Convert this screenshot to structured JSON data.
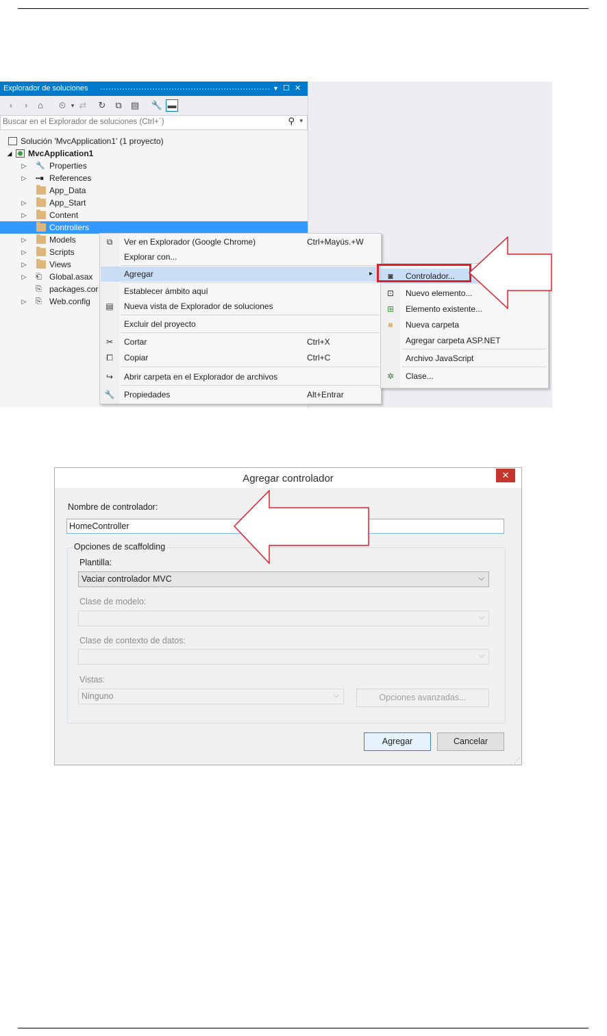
{
  "solution_explorer": {
    "title": "Explorador de soluciones",
    "search_placeholder": "Buscar en el Explorador de soluciones (Ctrl+´)",
    "tree": [
      {
        "label": "Solución 'MvcApplication1'  (1 proyecto)",
        "icon": "solution-icon"
      },
      {
        "label": "MvcApplication1",
        "icon": "web-project-icon"
      },
      {
        "label": "Properties",
        "icon": "wrench-icon"
      },
      {
        "label": "References",
        "icon": "references-icon"
      },
      {
        "label": "App_Data",
        "icon": "folder-icon"
      },
      {
        "label": "App_Start",
        "icon": "folder-icon"
      },
      {
        "label": "Content",
        "icon": "folder-icon"
      },
      {
        "label": "Controllers",
        "icon": "folder-icon",
        "selected": true
      },
      {
        "label": "Models",
        "icon": "folder-icon"
      },
      {
        "label": "Scripts",
        "icon": "folder-icon"
      },
      {
        "label": "Views",
        "icon": "folder-icon"
      },
      {
        "label": "Global.asax",
        "icon": "asax-file-icon"
      },
      {
        "label": "packages.cor",
        "icon": "config-file-icon"
      },
      {
        "label": "Web.config",
        "icon": "config-file-icon"
      }
    ]
  },
  "context_menu": {
    "items": [
      {
        "label": "Ver en Explorador (Google Chrome)",
        "shortcut": "Ctrl+Mayús.+W"
      },
      {
        "label": "Explorar con..."
      },
      {
        "label": "Agregar",
        "submenu_arrow": "▸"
      },
      {
        "label": "Establecer ámbito aquí"
      },
      {
        "label": "Nueva vista de Explorador de soluciones"
      },
      {
        "label": "Excluir del proyecto"
      },
      {
        "label": "Cortar",
        "shortcut": "Ctrl+X"
      },
      {
        "label": "Copiar",
        "shortcut": "Ctrl+C"
      },
      {
        "label": "Abrir carpeta en el Explorador de archivos"
      },
      {
        "label": "Propiedades",
        "shortcut": "Alt+Entrar"
      }
    ]
  },
  "add_submenu": {
    "items": [
      {
        "label": "Controlador..."
      },
      {
        "label": "Nuevo elemento..."
      },
      {
        "label": "Elemento existente..."
      },
      {
        "label": "Nueva carpeta"
      },
      {
        "label": "Agregar carpeta ASP.NET"
      },
      {
        "label": "Archivo JavaScript"
      },
      {
        "label": "Clase..."
      }
    ]
  },
  "dialog": {
    "title": "Agregar controlador",
    "close": "✕",
    "controller_name_label": "Nombre de controlador:",
    "controller_name_value": "HomeController",
    "scaffolding_group": "Opciones de scaffolding",
    "template_label": "Plantilla:",
    "template_value": "Vaciar controlador MVC",
    "model_class_label": "Clase de modelo:",
    "model_class_value": "",
    "data_context_label": "Clase de contexto de datos:",
    "data_context_value": "",
    "views_label": "Vistas:",
    "views_value": "Ninguno",
    "advanced_button": "Opciones avanzadas...",
    "add_button": "Agregar",
    "cancel_button": "Cancelar"
  },
  "colors": {
    "vs_accent": "#007acc",
    "selection": "#3399ff",
    "menu_highlight": "#c9def5",
    "callout_red": "#e01e2a"
  }
}
